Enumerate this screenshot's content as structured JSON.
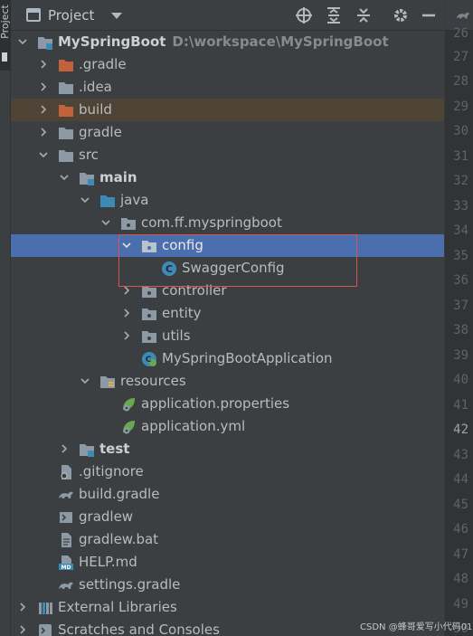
{
  "tool_strip": {
    "label": "Project"
  },
  "panel": {
    "title": "Project",
    "toolbar": [
      "locate-icon",
      "expand-all-icon",
      "collapse-all-icon",
      "settings-icon",
      "hide-icon"
    ]
  },
  "tree": {
    "root": {
      "label": "MySpringBoot",
      "path": "D:\\workspace\\MySpringBoot"
    },
    "gradle_dir": "gradle_dir_placeholder",
    "items": [
      {
        "label": ".gradle"
      },
      {
        "label": ".idea"
      },
      {
        "label": "build"
      },
      {
        "label": "gradle"
      },
      {
        "label": "src"
      },
      {
        "label": "main"
      },
      {
        "label": "java"
      },
      {
        "label": "com.ff.myspringboot"
      },
      {
        "label": "config"
      },
      {
        "label": "SwaggerConfig"
      },
      {
        "label": "controller"
      },
      {
        "label": "entity"
      },
      {
        "label": "utils"
      },
      {
        "label": "MySpringBootApplication"
      },
      {
        "label": "resources"
      },
      {
        "label": "application.properties"
      },
      {
        "label": "application.yml"
      },
      {
        "label": "test"
      },
      {
        "label": ".gitignore"
      },
      {
        "label": "build.gradle"
      },
      {
        "label": "gradlew"
      },
      {
        "label": "gradlew.bat"
      },
      {
        "label": "HELP.md"
      },
      {
        "label": "settings.gradle"
      },
      {
        "label": "External Libraries"
      },
      {
        "label": "Scratches and Consoles"
      }
    ]
  },
  "gutter": {
    "line_numbers": [
      "26",
      "27",
      "28",
      "29",
      "30",
      "31",
      "32",
      "33",
      "34",
      "35",
      "36",
      "37",
      "38",
      "39",
      "40",
      "41",
      "42",
      "43",
      "44",
      "45",
      "46",
      "47",
      "48",
      "49",
      "50"
    ],
    "current_line": "42"
  },
  "watermark": "CSDN @蜂哥爱写小代码01",
  "colors": {
    "selection": "#4b6eaf",
    "excluded_folder": "#c1623b",
    "highlight_box": "#d9534f",
    "folder": "#8d9aa6",
    "source_folder": "#3d8bb5"
  }
}
